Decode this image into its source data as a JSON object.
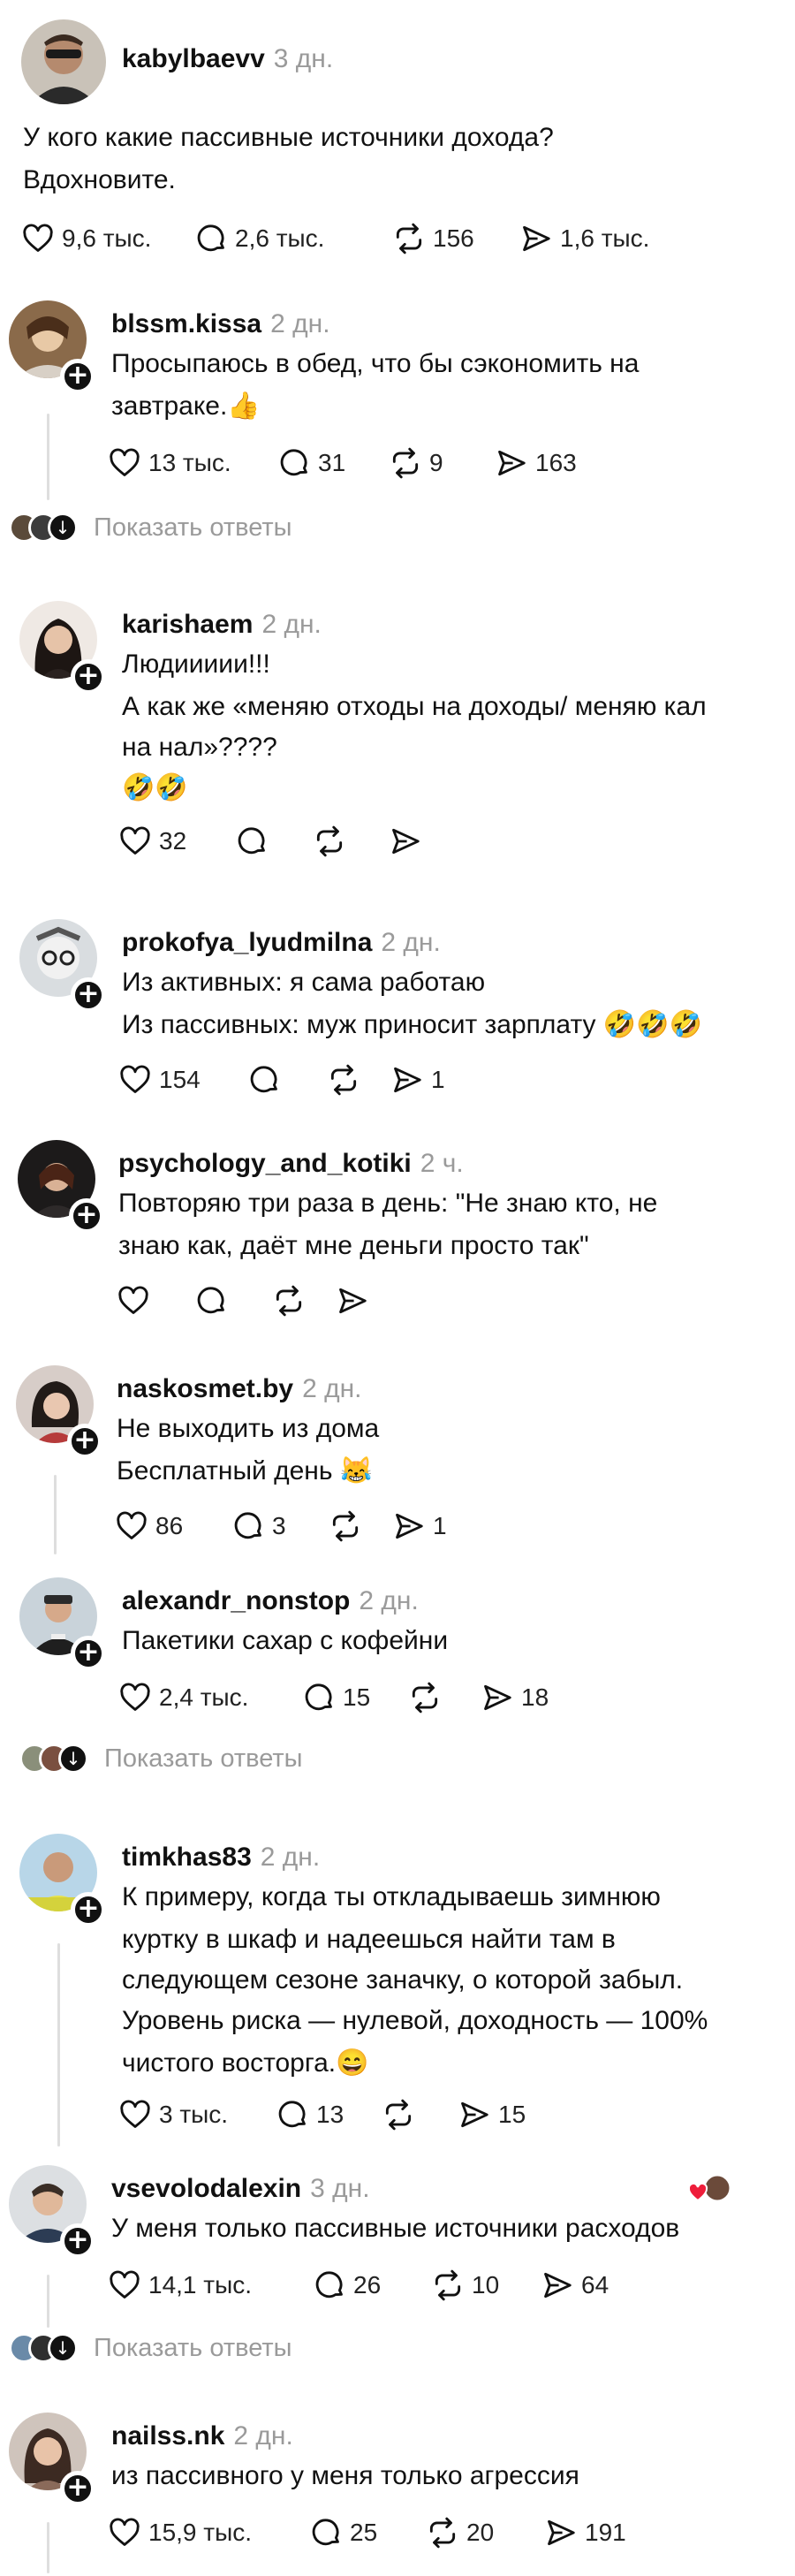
{
  "post": {
    "username": "kabylbaevv",
    "time": "3 дн.",
    "lines": [
      "У кого какие пассивные источники дохода?",
      "Вдохновите."
    ],
    "likes": "9,6 тыс.",
    "comments": "2,6 тыс.",
    "reposts": "156",
    "shares": "1,6 тыс."
  },
  "comments": [
    {
      "username": "blssm.kissa",
      "time": "2 дн.",
      "lines": [
        "Просыпаюсь в обед, что бы сэкономить на",
        "завтраке.👍"
      ],
      "likes": "13 тыс.",
      "comments": "31",
      "reposts": "9",
      "shares": "163",
      "show_replies": "Показать ответы"
    },
    {
      "username": "karishaem",
      "time": "2 дн.",
      "lines": [
        "Людиииии!!!",
        "А как же «меняю отходы на доходы/ меняю кал",
        "на нал»????",
        "🤣🤣"
      ],
      "likes": "32",
      "comments": "",
      "reposts": "",
      "shares": ""
    },
    {
      "username": "prokofya_lyudmilna",
      "time": "2 дн.",
      "lines": [
        "Из активных: я сама работаю",
        "Из пассивных: муж приносит зарплату 🤣🤣🤣"
      ],
      "likes": "154",
      "comments": "",
      "reposts": "",
      "shares": "1"
    },
    {
      "username": "psychology_and_kotiki",
      "time": "2 ч.",
      "lines": [
        "Повторяю три раза в день: \"Не знаю кто, не",
        "знаю как, даёт мне деньги просто так\""
      ],
      "likes": "",
      "comments": "",
      "reposts": "",
      "shares": ""
    },
    {
      "username": "naskosmet.by",
      "time": "2 дн.",
      "lines": [
        "Не выходить из дома",
        "Бесплатный день 😹"
      ],
      "likes": "86",
      "comments": "3",
      "reposts": "",
      "shares": "1"
    },
    {
      "username": "alexandr_nonstop",
      "time": "2 дн.",
      "lines": [
        "Пакетики сахар с  кофейни"
      ],
      "likes": "2,4 тыс.",
      "comments": "15",
      "reposts": "",
      "shares": "18",
      "show_replies": "Показать ответы"
    },
    {
      "username": "timkhas83",
      "time": "2 дн.",
      "lines": [
        "К примеру, когда ты откладываешь зимнюю",
        "куртку в шкаф и надеешься найти там в",
        "следующем сезоне заначку, о которой забыл.",
        "Уровень риска — нулевой, доходность — 100%",
        "чистого восторга.😄"
      ],
      "likes": "3 тыс.",
      "comments": "13",
      "reposts": "",
      "shares": "15"
    },
    {
      "username": "vsevolodalexin",
      "time": "3 дн.",
      "lines": [
        "У меня только пассивные источники расходов"
      ],
      "likes": "14,1 тыс.",
      "comments": "26",
      "reposts": "10",
      "shares": "64",
      "show_replies": "Показать ответы"
    },
    {
      "username": "nailss.nk",
      "time": "2 дн.",
      "lines": [
        "из пассивного у меня только агрессия"
      ],
      "likes": "15,9 тыс.",
      "comments": "25",
      "reposts": "20",
      "shares": "191"
    }
  ]
}
